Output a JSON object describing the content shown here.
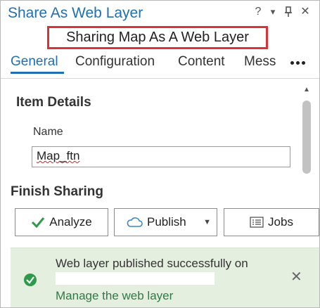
{
  "window": {
    "title": "Share As Web Layer",
    "controls": {
      "help": "?",
      "menu": "▾",
      "pin": "⊥",
      "close": "✕"
    }
  },
  "callout": {
    "text": "Sharing Map As A Web Layer"
  },
  "tabs": [
    {
      "label": "General",
      "active": true
    },
    {
      "label": "Configuration",
      "active": false
    },
    {
      "label": "Content",
      "active": false
    },
    {
      "label": "Mess",
      "active": false
    }
  ],
  "item_details": {
    "title": "Item Details",
    "name_label": "Name",
    "name_value": "Map_ftn"
  },
  "finish_sharing": {
    "title": "Finish Sharing",
    "buttons": {
      "analyze": "Analyze",
      "publish": "Publish",
      "jobs": "Jobs"
    }
  },
  "banner": {
    "message": "Web layer published successfully on",
    "link": "Manage the web layer",
    "close": "✕"
  },
  "colors": {
    "accent": "#1f6fb2",
    "callout_border": "#d9333a",
    "success": "#2e9a4a",
    "banner_bg": "#e5efe0"
  }
}
